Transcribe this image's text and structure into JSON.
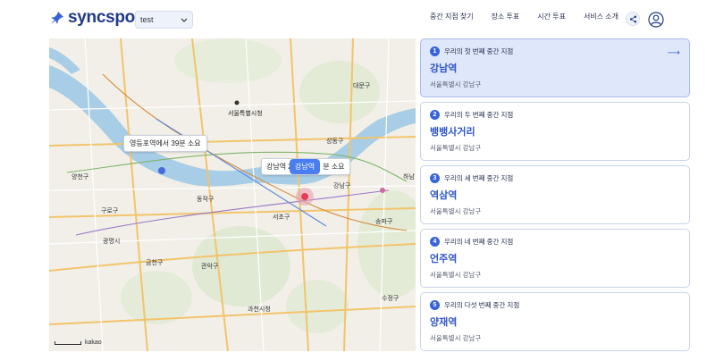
{
  "header": {
    "logo_text": "syncspot",
    "project_select": "test",
    "nav": [
      {
        "label": "중간 지점 찾기"
      },
      {
        "label": "장소 투표"
      },
      {
        "label": "시간 투표"
      },
      {
        "label": "서비스 소개"
      }
    ]
  },
  "map": {
    "tooltip_left": "영등포역에서 39분 소요",
    "tooltip_center": "강남역 2",
    "tooltip_center_suffix": "분 소요",
    "pill_label": "강남역",
    "scale_text": "kakao",
    "place_labels": [
      {
        "text": "서울특별시청"
      },
      {
        "text": "강남구"
      },
      {
        "text": "서초구"
      },
      {
        "text": "과천시청"
      },
      {
        "text": "광명시"
      },
      {
        "text": "구로구"
      },
      {
        "text": "금천구"
      },
      {
        "text": "동작구"
      },
      {
        "text": "관악구"
      },
      {
        "text": "양천구"
      },
      {
        "text": "송파구"
      },
      {
        "text": "성동구"
      },
      {
        "text": "대문구"
      },
      {
        "text": "수정구"
      },
      {
        "text": "하남"
      }
    ]
  },
  "results": [
    {
      "rank": "1",
      "heading": "우리의 첫 번째 중간 지점",
      "name": "강남역",
      "district": "서울특별시 강남구",
      "active": true
    },
    {
      "rank": "2",
      "heading": "우리의 두 번째 중간 지점",
      "name": "뱅뱅사거리",
      "district": "서울특별시 강남구",
      "active": false
    },
    {
      "rank": "3",
      "heading": "우리의 세 번째 중간 지점",
      "name": "역삼역",
      "district": "서울특별시 강남구",
      "active": false
    },
    {
      "rank": "4",
      "heading": "우리의 네 번째 중간 지점",
      "name": "언주역",
      "district": "서울특별시 강남구",
      "active": false
    },
    {
      "rank": "5",
      "heading": "우리의 다섯 번째 중간 지점",
      "name": "양재역",
      "district": "서울특별시 강남구",
      "active": false
    }
  ],
  "colors": {
    "brand": "#1e3a8a",
    "accent": "#3864d8",
    "active_card": "#dfe7fa",
    "river": "#a8cde6"
  },
  "icons": {
    "logo": "pin-icon",
    "share": "share-icon",
    "user": "user-icon",
    "arrow": "arrow-right-icon"
  }
}
